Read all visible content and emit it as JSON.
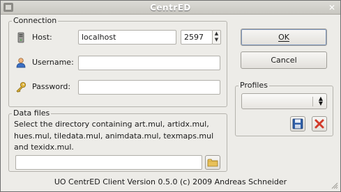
{
  "window": {
    "title": "CentrED"
  },
  "connection": {
    "legend": "Connection",
    "host_label": "Host:",
    "host_value": "localhost",
    "port_value": "2597",
    "username_label": "Username:",
    "username_value": "",
    "password_label": "Password:",
    "password_value": ""
  },
  "data_files": {
    "legend": "Data files",
    "description": "Select the directory containing art.mul, artidx.mul, hues.mul, tiledata.mul, animdata.mul, texmaps.mul and texidx.mul.",
    "path_value": ""
  },
  "buttons": {
    "ok_label": "OK",
    "cancel_label": "Cancel"
  },
  "profiles": {
    "legend": "Profiles",
    "selected": ""
  },
  "status": {
    "version_text": "UO CentrED Client Version 0.5.0 (c) 2009 Andreas Schneider"
  },
  "icons": {
    "host": "server-icon",
    "username": "user-icon",
    "password": "key-icon",
    "browse": "folder-icon",
    "save_profile": "floppy-save-icon",
    "delete_profile": "delete-x-icon"
  },
  "colors": {
    "delete_red": "#d23a2a",
    "save_blue": "#2f5fa8",
    "folder_yellow": "#e8c15a"
  }
}
